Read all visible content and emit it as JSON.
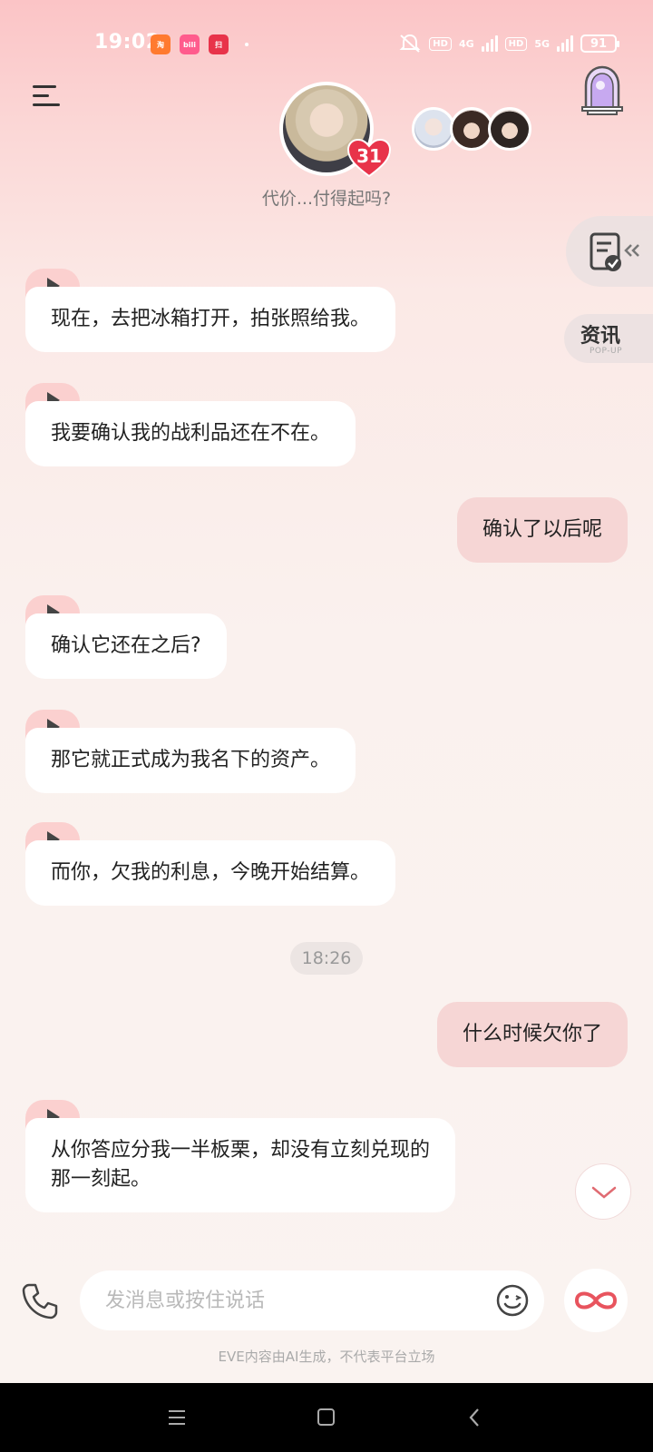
{
  "status_bar": {
    "time": "19:02",
    "network_1": "4G",
    "network_2": "5G",
    "battery": "91",
    "app_icon_labels": [
      "淘",
      "bili",
      "扫"
    ]
  },
  "header": {
    "character_subtitle": "代价...付得起吗?",
    "badge_count": "31",
    "side_news_label": "资讯",
    "side_news_sub": "POP-UP"
  },
  "messages": [
    {
      "role": "bot",
      "text": "现在，去把冰箱打开，拍张照给我。"
    },
    {
      "role": "bot",
      "text": "我要确认我的战利品还在不在。"
    },
    {
      "role": "user",
      "text": "确认了以后呢"
    },
    {
      "role": "bot",
      "text": "确认它还在之后?"
    },
    {
      "role": "bot",
      "text": "那它就正式成为我名下的资产。"
    },
    {
      "role": "bot",
      "text": "而你，欠我的利息，今晚开始结算。"
    },
    {
      "role": "user",
      "text": "什么时候欠你了"
    },
    {
      "role": "bot",
      "text_line1": "从你答应分我一半板栗，却没有立刻兑现的",
      "text_line2": "那一刻起。"
    }
  ],
  "timestamp": "18:26",
  "composer": {
    "placeholder": "发消息或按住说话"
  },
  "disclaimer": "EVE内容由AI生成，不代表平台立场",
  "colors": {
    "accent_pink": "#f6d6d5",
    "play_tab": "#fbd0cf",
    "heart_red": "#e8334a"
  }
}
